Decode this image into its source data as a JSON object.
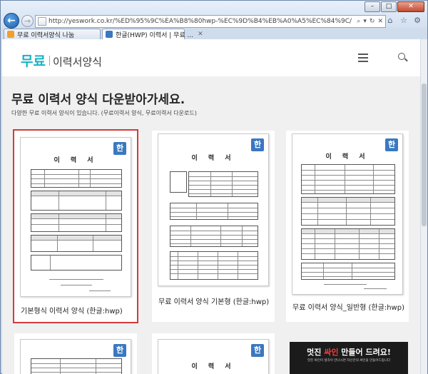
{
  "browser": {
    "url": "http://yeswork.co.kr/%ED%95%9C%EA%B8%80hwp-%EC%9D%B4%EB%A0%A5%EC%84%9C/",
    "tabs": [
      {
        "label": "무료 이력서양식 나눔",
        "active": false
      },
      {
        "label": "한글(HWP) 이력서 | 무료 ...",
        "active": true
      }
    ],
    "controls": {
      "minimize": "–",
      "maximize": "□",
      "close": "✕"
    }
  },
  "site": {
    "logo_main": "무료",
    "logo_sub": "이력서양식"
  },
  "page": {
    "title": "무료 이력서 양식 다운받아가세요.",
    "description": "다양한 무료 이력서 양식이 있습니다. (무료이력서 양식, 무료이력서 다운로드)"
  },
  "cards": [
    {
      "caption": "기본형식 이력서 양식 (한글:hwp)",
      "doc_title": "이 력 서",
      "badge": "한",
      "selected": true
    },
    {
      "caption": "무료 이력서 양식 기본형 (한글:hwp)",
      "doc_title": "이 력 서",
      "badge": "한",
      "selected": false
    },
    {
      "caption": "무료 이력서 양식_일반형 (한글:hwp)",
      "doc_title": "이 력 서",
      "badge": "한",
      "selected": false
    }
  ],
  "second_row": {
    "card2_doc_title": "이 력 서",
    "badge": "한"
  },
  "ad": {
    "headline_pre": "멋진 ",
    "headline_highlight": "싸인",
    "headline_post": " 만들어 드려요!",
    "sub": "멋진 싸인이 생각이 안나시면 자신만의 싸인을 만들어드립니다"
  },
  "colors": {
    "brand": "#19b3c4",
    "selection_border": "#d43a3a",
    "hwp_badge": "#3a78c0"
  },
  "icons": {
    "back": "arrow-left-icon",
    "forward": "arrow-right-icon",
    "menu": "hamburger-icon",
    "search": "search-icon",
    "hwp": "hwp-badge-icon"
  }
}
